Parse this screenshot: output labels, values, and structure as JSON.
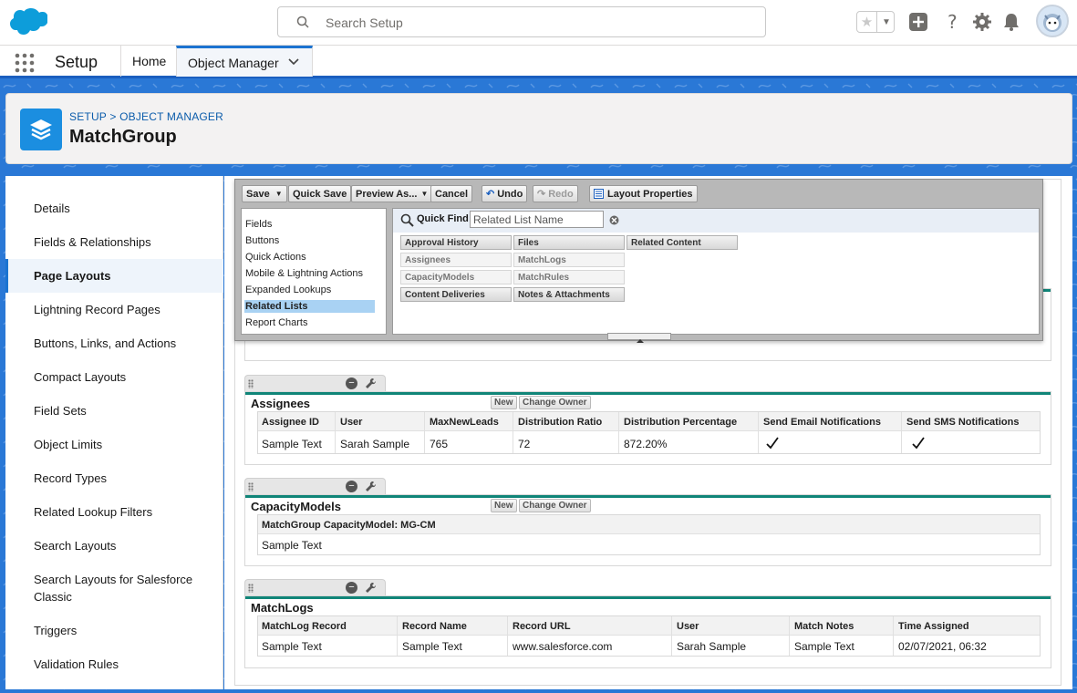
{
  "global_header": {
    "search_placeholder": "Search Setup"
  },
  "nav": {
    "app_name": "Setup",
    "tabs": [
      {
        "label": "Home"
      },
      {
        "label": "Object Manager",
        "active": true
      }
    ]
  },
  "page_header": {
    "breadcrumb_setup": "SETUP",
    "breadcrumb_sep": " > ",
    "breadcrumb_object_manager": "OBJECT MANAGER",
    "title": "MatchGroup"
  },
  "sidebar": {
    "items": [
      {
        "label": "Details"
      },
      {
        "label": "Fields & Relationships"
      },
      {
        "label": "Page Layouts",
        "selected": true
      },
      {
        "label": "Lightning Record Pages"
      },
      {
        "label": "Buttons, Links, and Actions"
      },
      {
        "label": "Compact Layouts"
      },
      {
        "label": "Field Sets"
      },
      {
        "label": "Object Limits"
      },
      {
        "label": "Record Types"
      },
      {
        "label": "Related Lookup Filters"
      },
      {
        "label": "Search Layouts"
      },
      {
        "label": "Search Layouts for Salesforce Classic"
      },
      {
        "label": "Triggers"
      },
      {
        "label": "Validation Rules"
      }
    ]
  },
  "palette": {
    "toolbar": {
      "save": "Save",
      "quick_save": "Quick Save",
      "preview_as": "Preview As...",
      "cancel": "Cancel",
      "undo": "Undo",
      "redo": "Redo",
      "layout_properties": "Layout Properties"
    },
    "categories": [
      {
        "label": "Fields"
      },
      {
        "label": "Buttons"
      },
      {
        "label": "Quick Actions"
      },
      {
        "label": "Mobile & Lightning Actions"
      },
      {
        "label": "Expanded Lookups"
      },
      {
        "label": "Related Lists",
        "selected": true
      },
      {
        "label": "Report Charts"
      }
    ],
    "quick_find_label": "Quick Find",
    "quick_find_placeholder": "Related List Name",
    "items": [
      {
        "label": "Approval History",
        "used": false
      },
      {
        "label": "Files",
        "used": false
      },
      {
        "label": "Related Content",
        "used": false
      },
      {
        "label": "Assignees",
        "used": true
      },
      {
        "label": "MatchLogs",
        "used": true
      },
      {
        "label": "CapacityModels",
        "used": true
      },
      {
        "label": "MatchRules",
        "used": true
      },
      {
        "label": "Content Deliveries",
        "used": false
      },
      {
        "label": "Notes & Attachments",
        "used": false
      }
    ]
  },
  "related_lists": {
    "assignees": {
      "title": "Assignees",
      "btn_new": "New",
      "btn_change_owner": "Change Owner",
      "columns": [
        "Assignee ID",
        "User",
        "MaxNewLeads",
        "Distribution Ratio",
        "Distribution Percentage",
        "Send Email Notifications",
        "Send SMS Notifications"
      ],
      "row": [
        "Sample Text",
        "Sarah Sample",
        "765",
        "72",
        "872.20%"
      ]
    },
    "capacity_models": {
      "title": "CapacityModels",
      "btn_new": "New",
      "btn_change_owner": "Change Owner",
      "columns": [
        "MatchGroup CapacityModel: MG-CM"
      ],
      "row": [
        "Sample Text"
      ]
    },
    "match_logs": {
      "title": "MatchLogs",
      "columns": [
        "MatchLog Record",
        "Record Name",
        "Record URL",
        "User",
        "Match Notes",
        "Time Assigned"
      ],
      "row": [
        "Sample Text",
        "Sample Text",
        "www.salesforce.com",
        "Sarah Sample",
        "Sample Text",
        "02/07/2021, 06:32"
      ]
    }
  }
}
